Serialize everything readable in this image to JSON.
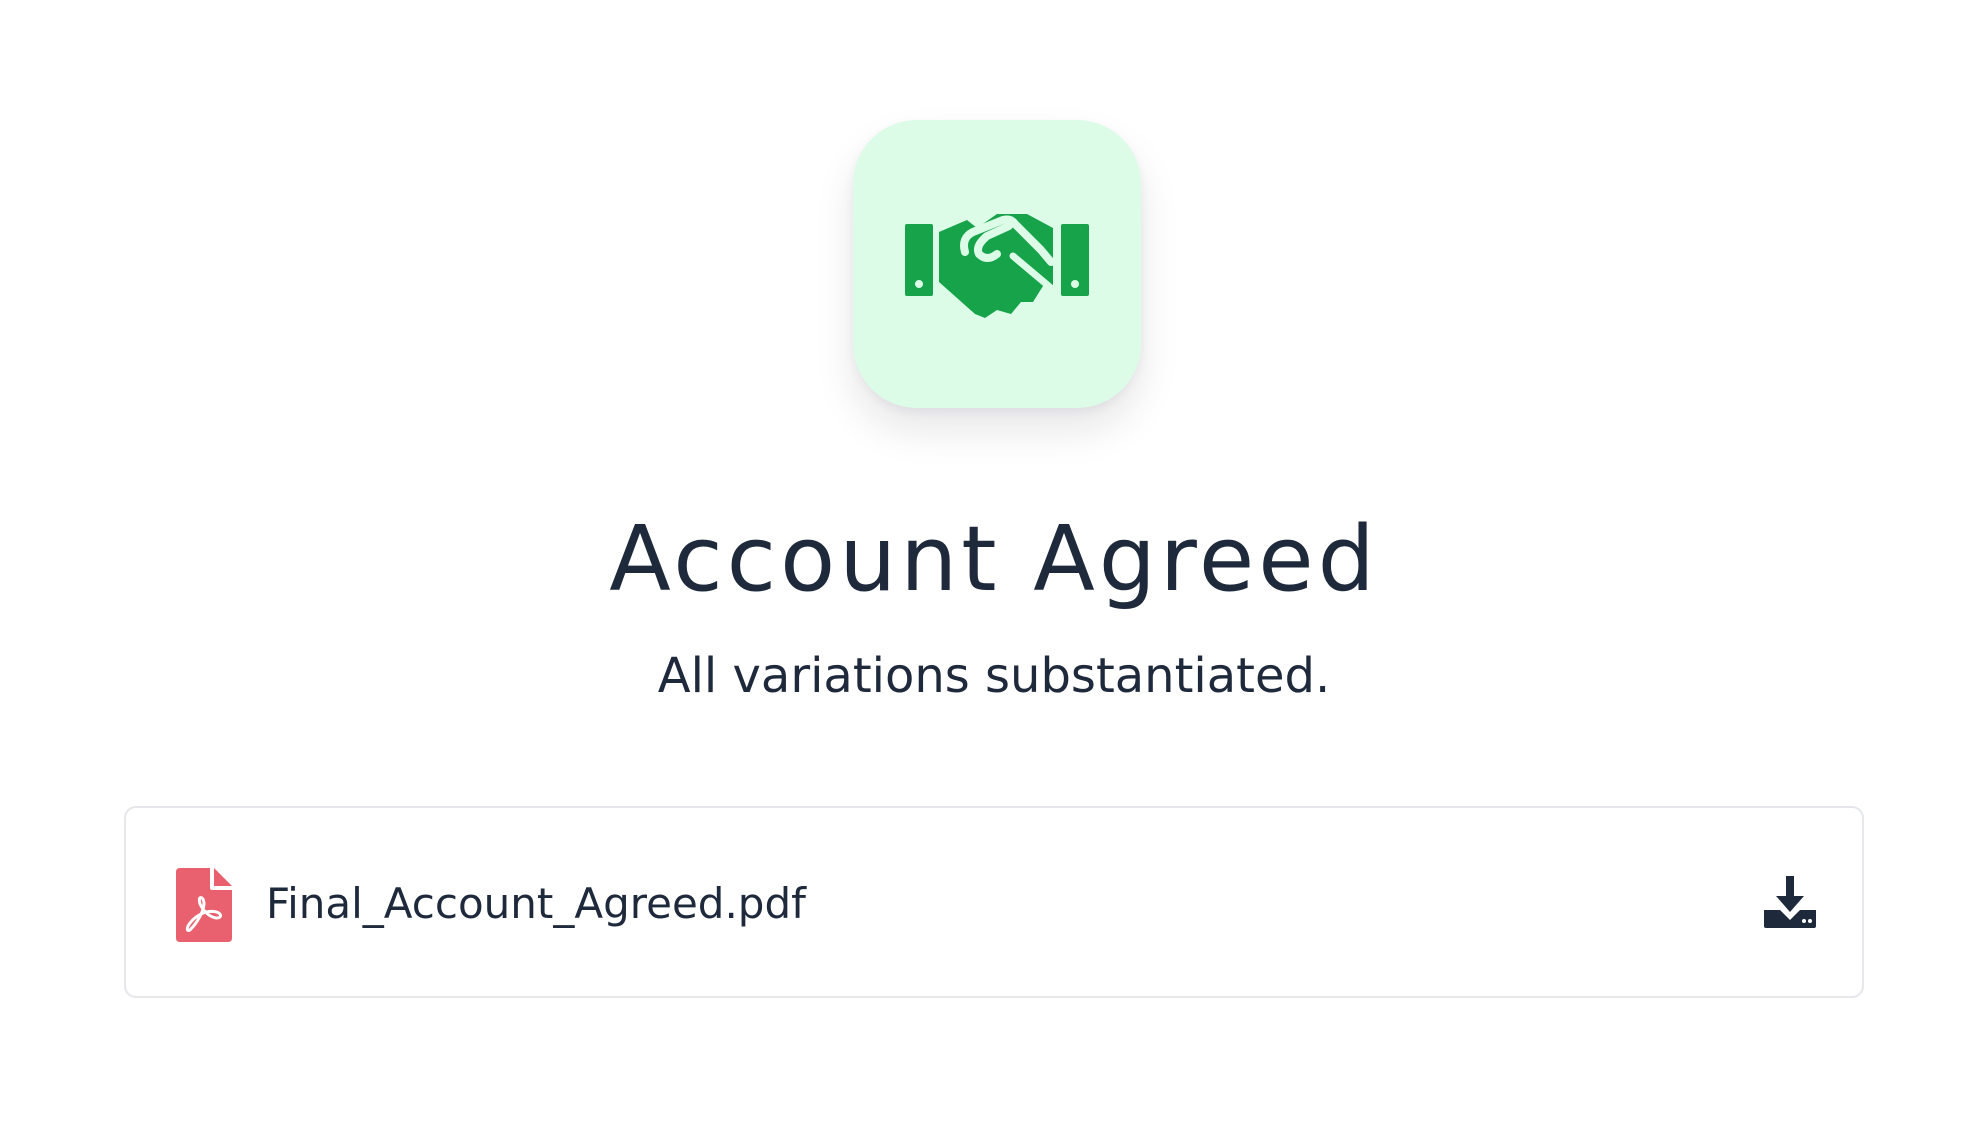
{
  "hero": {
    "icon": "handshake-icon",
    "tile_color": "#dcfce7",
    "icon_color": "#16a34a"
  },
  "title": "Account Agreed",
  "subtitle": "All variations substantiated.",
  "attachment": {
    "file_icon": "pdf-file-icon",
    "file_icon_color": "#e9606e",
    "file_name": "Final_Account_Agreed.pdf",
    "action_icon": "download-icon",
    "action_icon_color": "#1e293b"
  }
}
